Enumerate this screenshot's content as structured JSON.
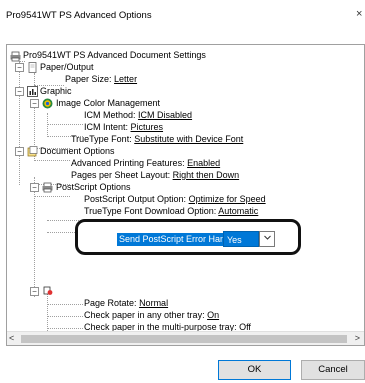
{
  "window": {
    "title": "Pro9541WT PS Advanced Options",
    "close_glyph": "×"
  },
  "tree": {
    "root_label": "Pro9541WT PS Advanced Document Settings",
    "paper_output": {
      "label": "Paper/Output",
      "paper_size_label": "Paper Size:",
      "paper_size_value": "Letter"
    },
    "graphic": {
      "label": "Graphic",
      "icm": {
        "label": "Image Color Management",
        "method_label": "ICM Method:",
        "method_value": "ICM Disabled",
        "intent_label": "ICM Intent:",
        "intent_value": "Pictures"
      },
      "truetype_label": "TrueType Font:",
      "truetype_value": "Substitute with Device Font"
    },
    "document_options": {
      "label": "Document Options",
      "advanced_label": "Advanced Printing Features:",
      "advanced_value": "Enabled",
      "pages_label": "Pages per Sheet Layout:",
      "pages_value": "Right then Down",
      "postscript": {
        "label": "PostScript Options",
        "output_label": "PostScript Output Option:",
        "output_value": "Optimize for Speed",
        "ttdownload_label": "TrueType Font Download Option:",
        "ttdownload_value": "Automatic",
        "error_handler_label": "Send PostScript Error Handler:",
        "error_handler_value": "Yes"
      }
    },
    "printer_features": {
      "page_rotate_label": "Page Rotate:",
      "page_rotate_value": "Normal",
      "any_tray_label": "Check paper in any other tray:",
      "any_tray_value": "On",
      "mp_tray_label": "Check paper in the multi-purpose tray:",
      "mp_tray_value": "Off"
    }
  },
  "scroll": {
    "left_glyph": "<",
    "right_glyph": ">"
  },
  "buttons": {
    "ok": "OK",
    "cancel": "Cancel"
  },
  "colors": {
    "selection": "#0078d7",
    "border": "#a0a0a0",
    "highlight_outline": "#111111"
  }
}
